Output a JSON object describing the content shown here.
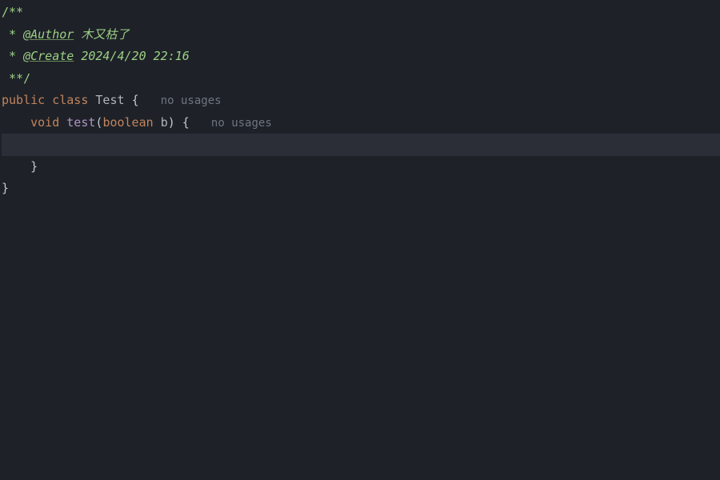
{
  "line1": {
    "comment_open": "/**"
  },
  "line2": {
    "star": " * ",
    "tag": "@Author",
    "sp": " ",
    "value": "木又枯了"
  },
  "line3": {
    "star": " * ",
    "tag": "@Create",
    "sp": " ",
    "value": "2024/4/20 22:16"
  },
  "line4": {
    "comment_close": " **/"
  },
  "line5": {
    "kw_public": "public",
    "sp1": " ",
    "kw_class": "class",
    "sp2": " ",
    "class_name": "Test",
    "sp3": " ",
    "brace": "{",
    "sp4": "   ",
    "hint": "no usages"
  },
  "line6": {
    "indent": "    ",
    "kw_void": "void",
    "sp1": " ",
    "method": "test",
    "lparen": "(",
    "kw_boolean": "boolean",
    "sp2": " ",
    "param": "b",
    "rparen": ")",
    "sp3": " ",
    "brace": "{",
    "sp4": "   ",
    "hint": "no usages"
  },
  "line7": {
    "blank": ""
  },
  "line8": {
    "indent": "    ",
    "brace": "}"
  },
  "line9": {
    "brace": "}"
  }
}
